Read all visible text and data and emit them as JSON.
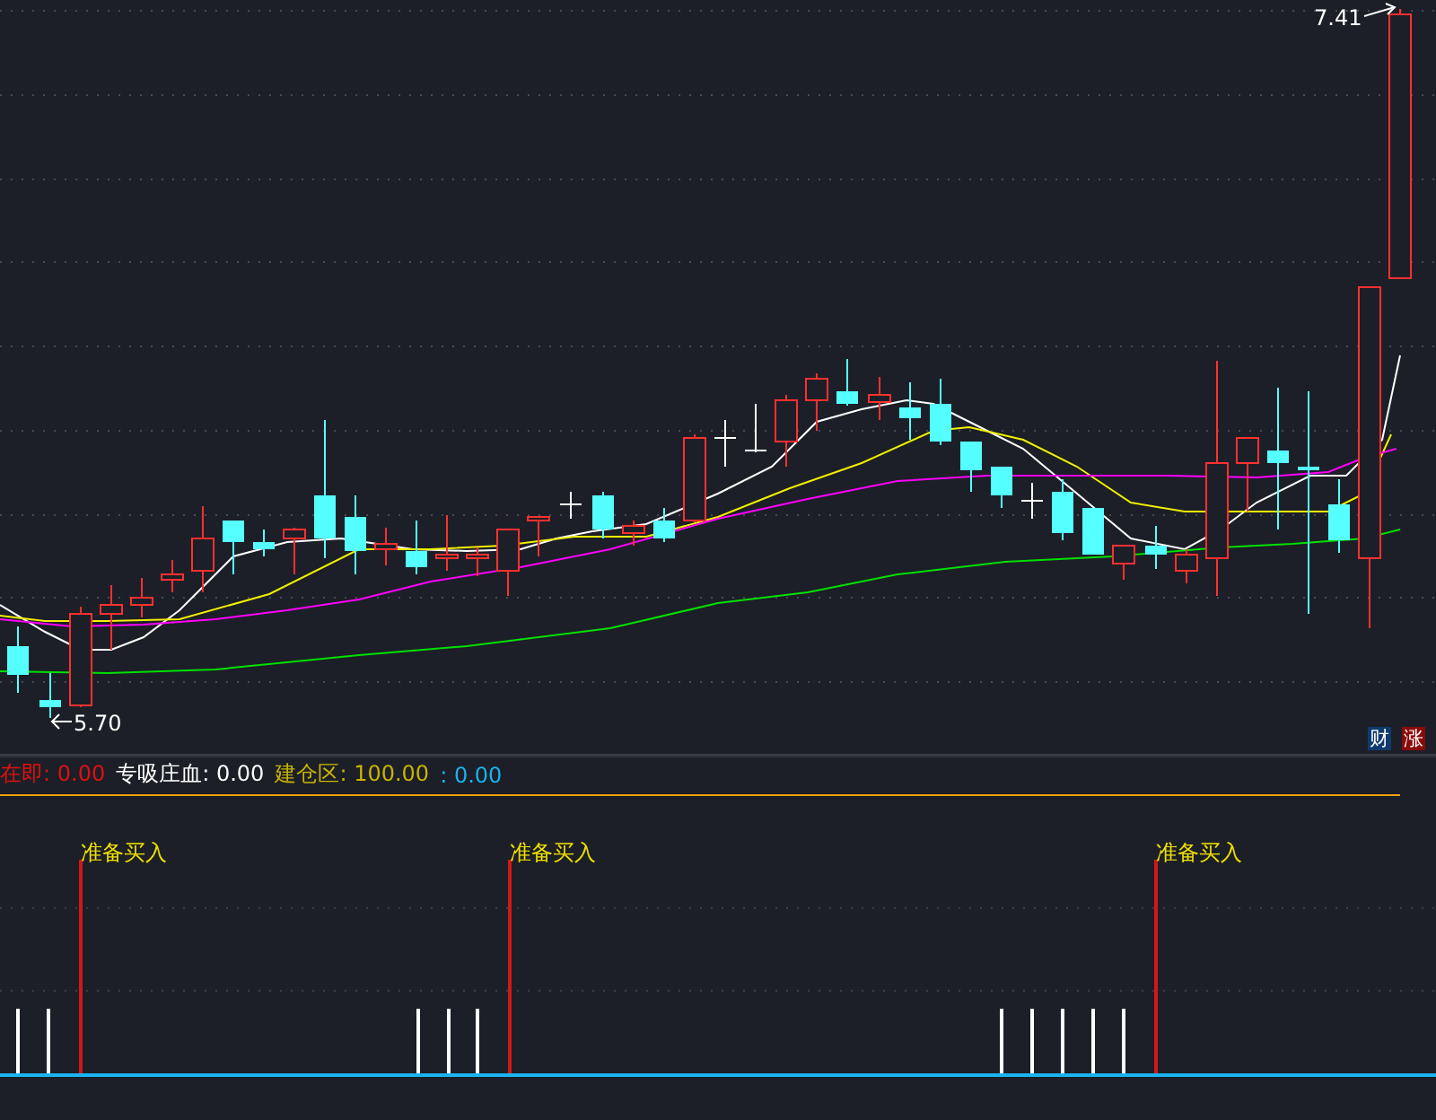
{
  "price_chart": {
    "high_label": "7.41",
    "low_label": "5.70",
    "badges": [
      {
        "text": "财",
        "color": "#0f3a6e"
      },
      {
        "text": "涨",
        "color": "#8a0a0a"
      }
    ]
  },
  "indicator_legend": [
    {
      "label": "在即:",
      "value": "0.00",
      "color": "#e01010"
    },
    {
      "label": "专吸庄血:",
      "value": "0.00",
      "color": "#ffffff"
    },
    {
      "label": "建仓区:",
      "value": "100.00",
      "color": "#c8b400"
    },
    {
      "label": ":",
      "value": "0.00",
      "color": "#16b4f0"
    }
  ],
  "signal_panel": {
    "signals": [
      {
        "label": "准备买入"
      },
      {
        "label": "准备买入"
      },
      {
        "label": "准备买入"
      }
    ]
  }
}
